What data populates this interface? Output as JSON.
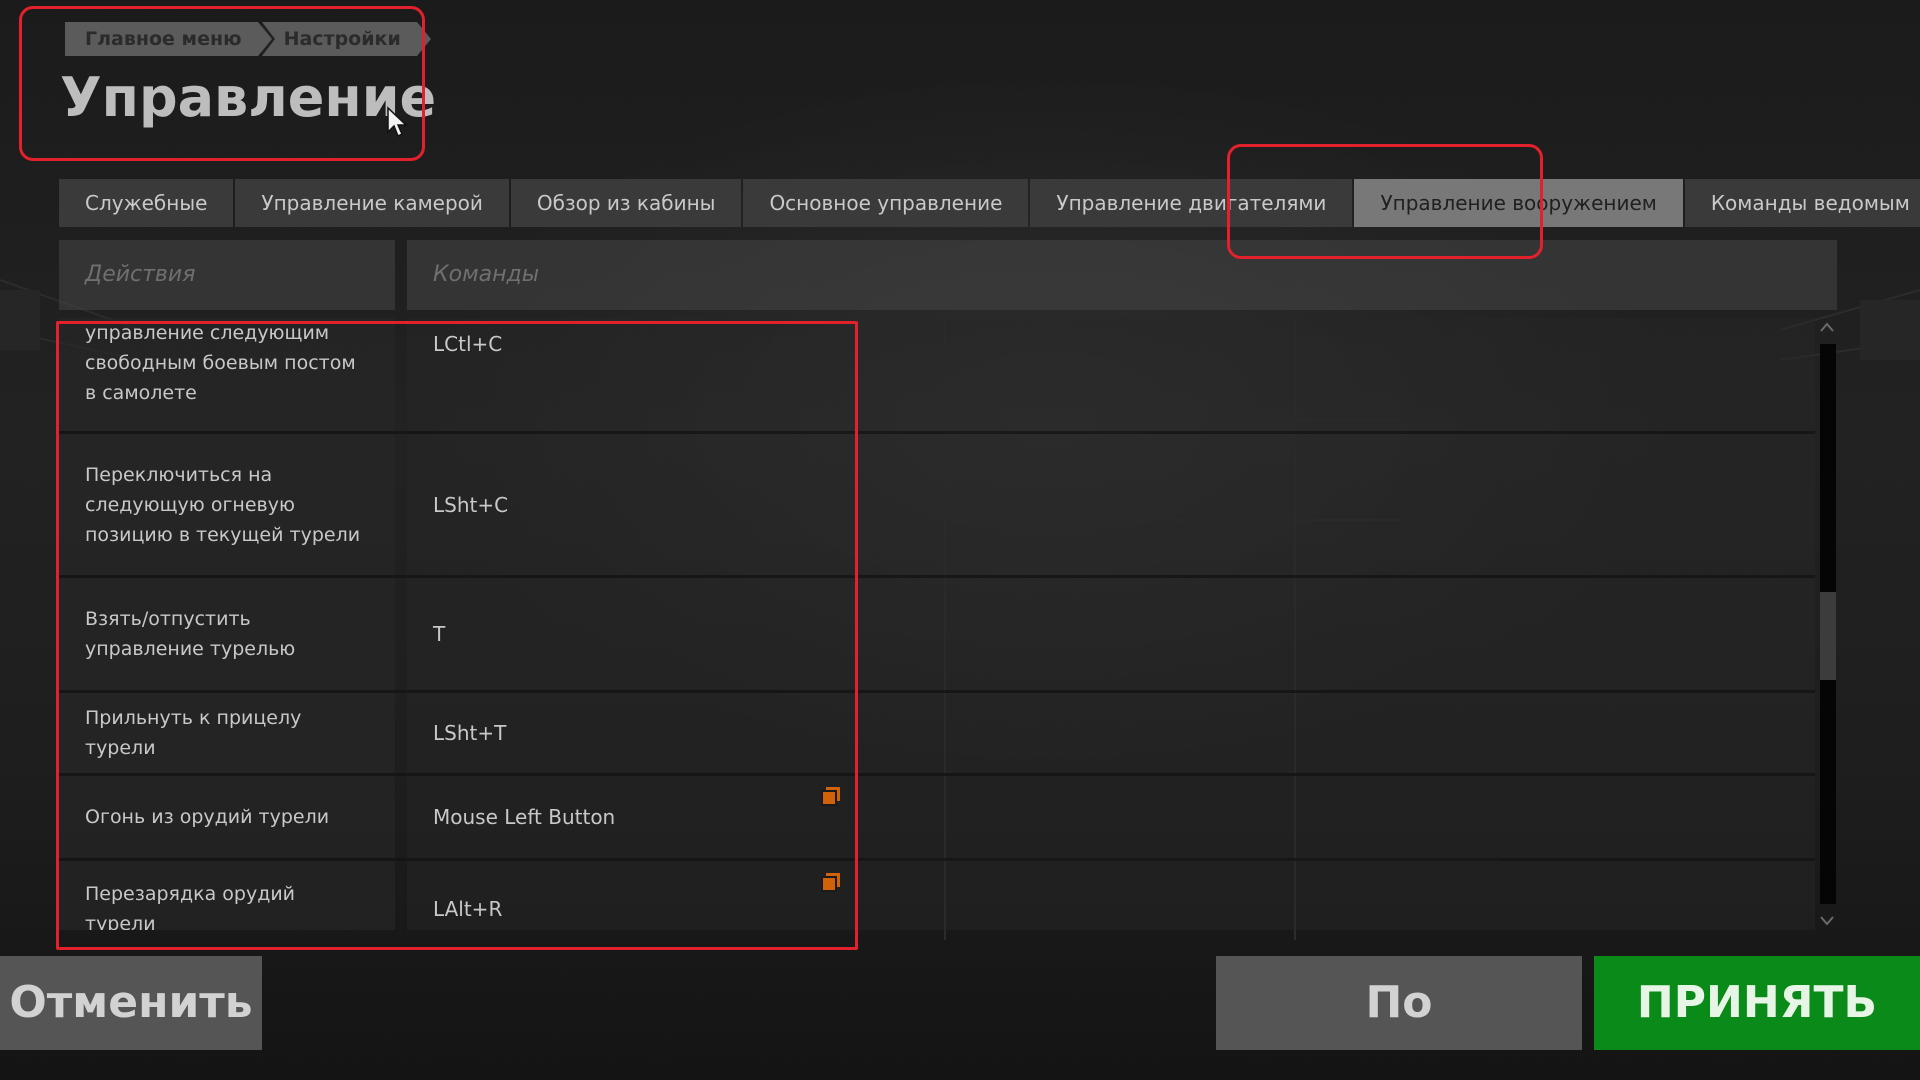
{
  "breadcrumb": {
    "items": [
      "Главное меню",
      "Настройки"
    ]
  },
  "page": {
    "title": "Управление"
  },
  "tabs": [
    {
      "label": "Служебные",
      "active": false
    },
    {
      "label": "Управление камерой",
      "active": false
    },
    {
      "label": "Обзор из кабины",
      "active": false
    },
    {
      "label": "Основное управление",
      "active": false
    },
    {
      "label": "Управление двигателями",
      "active": false
    },
    {
      "label": "Управление вооружением",
      "active": true
    },
    {
      "label": "Команды ведомым",
      "active": false
    }
  ],
  "table": {
    "headers": {
      "actions": "Действия",
      "commands": "Команды"
    },
    "rows": [
      {
        "action": "управление следующим свободным боевым постом в самолете",
        "command": "LCtl+C",
        "copy_icon": false
      },
      {
        "action": "Переключиться на следующую огневую позицию в текущей турели",
        "command": "LSht+C",
        "copy_icon": false
      },
      {
        "action": "Взять/отпустить управление турелью",
        "command": "T",
        "copy_icon": false
      },
      {
        "action": "Прильнуть к прицелу турели",
        "command": "LSht+T",
        "copy_icon": false
      },
      {
        "action": "Огонь из орудий турели",
        "command": "Mouse Left Button",
        "copy_icon": true
      },
      {
        "action": "Перезарядка орудий турели",
        "command": "LAlt+R",
        "copy_icon": true
      }
    ]
  },
  "buttons": {
    "cancel": "Отменить",
    "default": "По умолчанию",
    "accept": "ПРИНЯТЬ"
  },
  "colors": {
    "accept": "#0a8a18",
    "highlight": "#e3212c",
    "copy_icon": "#d2620a"
  }
}
